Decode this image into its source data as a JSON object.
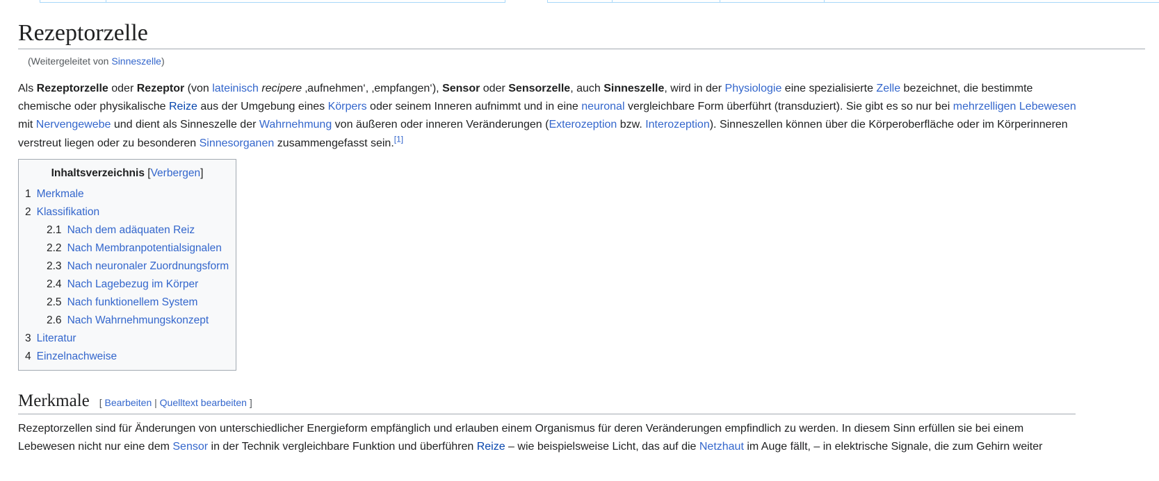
{
  "article": {
    "title": "Rezeptorzelle",
    "redirect_prefix": "(Weitergeleitet von ",
    "redirect_link": "Sinneszelle",
    "redirect_suffix": ")"
  },
  "intro": {
    "t1": "Als ",
    "b1": "Rezeptorzelle",
    "t2": " oder ",
    "b2": "Rezeptor",
    "t3": " (von ",
    "l_lateinisch": "lateinisch",
    "t4": " ",
    "i_recipere": "recipere",
    "t5": " ‚aufnehmen‘, ‚empfangen‘), ",
    "b3": "Sensor",
    "t6": " oder ",
    "b4": "Sensorzelle",
    "t7": ", auch ",
    "b5": "Sinneszelle",
    "t8": ", wird in der ",
    "l_physiologie": "Physiologie",
    "t9": " eine spezialisierte ",
    "l_zelle": "Zelle",
    "t10": " bezeichnet, die bestimmte chemische oder physikalische ",
    "l_reize": "Reize",
    "t11": " aus der Umgebung eines ",
    "l_koerpers": "Körpers",
    "t12": " oder seinem Inneren aufnimmt und in eine ",
    "l_neuronal": "neuronal",
    "t13": " vergleichbare Form überführt (transduziert). Sie gibt es so nur bei ",
    "l_mehrzelligen": "mehrzelligen Lebewesen",
    "t14": " mit ",
    "l_nervengewebe": "Nervengewebe",
    "t15": " und dient als Sinneszelle der ",
    "l_wahrnehmung": "Wahrnehmung",
    "t16": " von äußeren oder inneren Veränderungen (",
    "l_exterozeption": "Exterozeption",
    "t17": " bzw. ",
    "l_interozeption": "Interozeption",
    "t18": "). Sinneszellen können über die Körperoberfläche oder im Körperinneren verstreut liegen oder zu besonderen ",
    "l_sinnesorganen": "Sinnesorganen",
    "t19": " zusammengefasst sein.",
    "ref": "[1]"
  },
  "toc": {
    "title": "Inhaltsverzeichnis",
    "open_bracket": "[",
    "toggle": "Verbergen",
    "close_bracket": "]",
    "items": [
      {
        "num": "1",
        "label": "Merkmale"
      },
      {
        "num": "2",
        "label": "Klassifikation"
      },
      {
        "num": "2.1",
        "label": "Nach dem adäquaten Reiz"
      },
      {
        "num": "2.2",
        "label": "Nach Membranpotentialsignalen"
      },
      {
        "num": "2.3",
        "label": "Nach neuronaler Zuordnungsform"
      },
      {
        "num": "2.4",
        "label": "Nach Lagebezug im Körper"
      },
      {
        "num": "2.5",
        "label": "Nach funktionellem System"
      },
      {
        "num": "2.6",
        "label": "Nach Wahrnehmungskonzept"
      },
      {
        "num": "3",
        "label": "Literatur"
      },
      {
        "num": "4",
        "label": "Einzelnachweise"
      }
    ]
  },
  "section_merkmale": {
    "heading": "Merkmale",
    "edit_open": "[ ",
    "edit_label": "Bearbeiten",
    "edit_sep": " | ",
    "source_label": "Quelltext bearbeiten",
    "edit_close": " ]",
    "p1": "Rezeptorzellen sind für Änderungen von unterschiedlicher Energieform empfänglich und erlauben einem Organismus für deren Veränderungen empfindlich zu werden. In diesem Sinn erfüllen sie bei einem Lebewesen nicht nur eine dem ",
    "l_sensor": "Sensor",
    "p2": " in der Technik vergleichbare Funktion und überführen ",
    "l_reize": "Reize",
    "p3": " – wie beispielsweise Licht, das auf die ",
    "l_netzhaut": "Netzhaut",
    "p4": " im Auge fällt, – in elektrische Signale, die zum Gehirn weiter"
  }
}
